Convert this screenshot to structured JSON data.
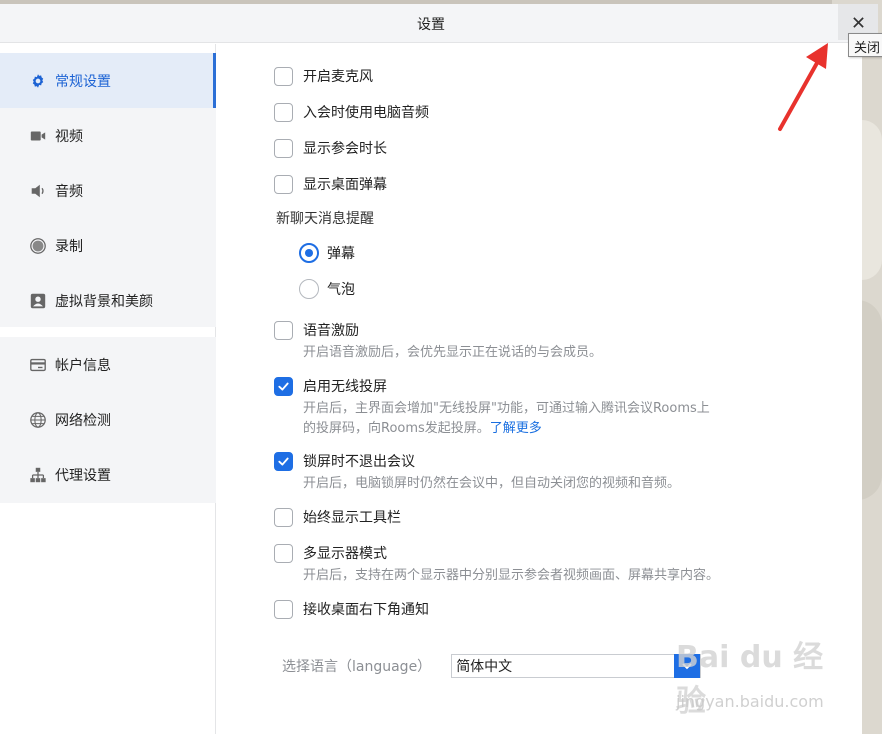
{
  "window": {
    "title": "设置",
    "close_tooltip": "关闭"
  },
  "sidebar": {
    "group1": [
      {
        "label": "常规设置",
        "icon": "gear-icon",
        "active": true
      },
      {
        "label": "视频",
        "icon": "video-camera-icon",
        "active": false
      },
      {
        "label": "音频",
        "icon": "speaker-icon",
        "active": false
      },
      {
        "label": "录制",
        "icon": "record-icon",
        "active": false
      },
      {
        "label": "虚拟背景和美颜",
        "icon": "portrait-icon",
        "active": false
      }
    ],
    "group2": [
      {
        "label": "帐户信息",
        "icon": "card-icon"
      },
      {
        "label": "网络检测",
        "icon": "globe-icon"
      },
      {
        "label": "代理设置",
        "icon": "network-tree-icon"
      }
    ]
  },
  "settings": {
    "mic": {
      "label": "开启麦克风",
      "checked": false
    },
    "pc_audio": {
      "label": "入会时使用电脑音频",
      "checked": false
    },
    "show_duration": {
      "label": "显示参会时长",
      "checked": false
    },
    "desktop_danmaku": {
      "label": "显示桌面弹幕",
      "checked": false
    },
    "chat_reminder": {
      "label": "新聊天消息提醒",
      "options": [
        {
          "label": "弹幕",
          "checked": true
        },
        {
          "label": "气泡",
          "checked": false
        }
      ]
    },
    "voice_motivation": {
      "label": "语音激励",
      "checked": false,
      "desc": "开启语音激励后，会优先显示正在说话的与会成员。"
    },
    "wireless_cast": {
      "label": "启用无线投屏",
      "checked": true,
      "desc_line1": "开启后，主界面会增加\"无线投屏\"功能，可通过输入腾讯会议Rooms上",
      "desc_line2": "的投屏码，向Rooms发起投屏。",
      "learn_more": "了解更多"
    },
    "lock_screen": {
      "label": "锁屏时不退出会议",
      "checked": true,
      "desc": "开启后，电脑锁屏时仍然在会议中，但自动关闭您的视频和音频。"
    },
    "toolbar": {
      "label": "始终显示工具栏",
      "checked": false
    },
    "multi_monitor": {
      "label": "多显示器模式",
      "checked": false,
      "desc": "开启后，支持在两个显示器中分别显示参会者视频画面、屏幕共享内容。"
    },
    "corner_notify": {
      "label": "接收桌面右下角通知",
      "checked": false
    },
    "language": {
      "label": "选择语言（language）",
      "value": "简体中文"
    }
  },
  "watermark": {
    "text": "Bai du 经验",
    "sub": "jingyan.baidu.com"
  },
  "colors": {
    "accent": "#1e6ee4",
    "active_bg": "#e4ecf8",
    "annotation_arrow": "#e8322d"
  }
}
